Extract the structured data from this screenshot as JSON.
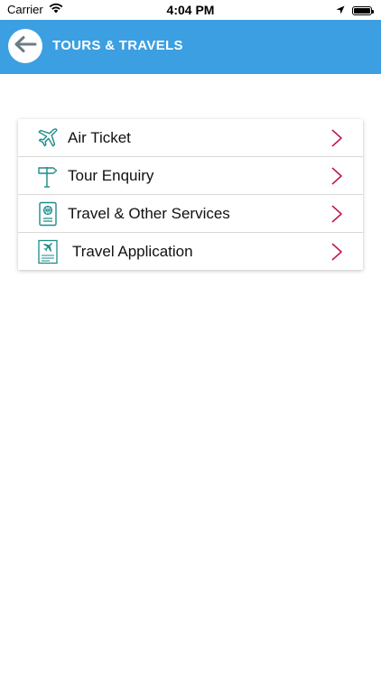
{
  "status_bar": {
    "carrier": "Carrier",
    "time": "4:04 PM",
    "icons": [
      "wifi-icon",
      "location-arrow-icon",
      "battery-icon"
    ]
  },
  "header": {
    "title": "TOURS & TRAVELS",
    "back_icon": "back-arrow-icon",
    "background_color": "#3b9fe2"
  },
  "menu": {
    "items": [
      {
        "label": "Air Ticket",
        "icon": "airplane-icon"
      },
      {
        "label": "Tour Enquiry",
        "icon": "signpost-icon"
      },
      {
        "label": "Travel & Other Services",
        "icon": "passport-icon"
      },
      {
        "label": "Travel Application",
        "icon": "travel-document-icon"
      }
    ],
    "chevron_color": "#c2185b",
    "icon_color": "#1f8a8a"
  }
}
